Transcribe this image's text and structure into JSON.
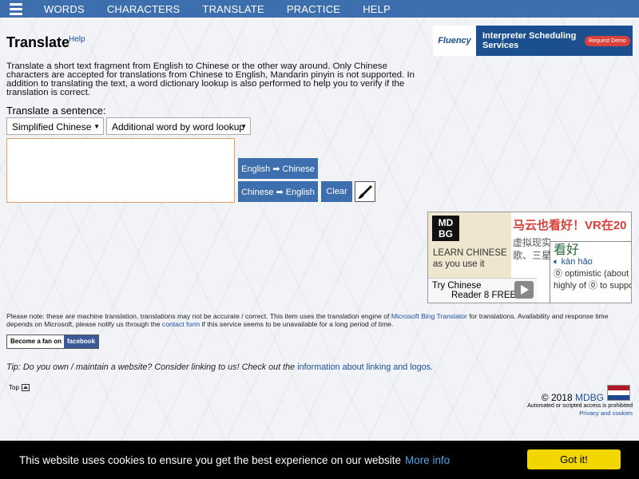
{
  "nav": {
    "items": [
      "WORDS",
      "CHARACTERS",
      "TRANSLATE",
      "PRACTICE",
      "HELP"
    ]
  },
  "page": {
    "title": "Translate",
    "help_label": "Help",
    "intro": "Translate a short text fragment from English to Chinese or the other way around. Only Chinese characters are accepted for translations from Chinese to English, Mandarin pinyin is not supported. In addition to translating the text, a word dictionary lookup is also performed to help you to verify if the translation is correct.",
    "sentence_label": "Translate a sentence:"
  },
  "form": {
    "language_select": "Simplified Chinese",
    "mode_select": "Additional word by word lookup",
    "textarea_value": "",
    "btn_en_zh": "English ➡ Chinese",
    "btn_zh_en": "Chinese ➡ English",
    "btn_clear": "Clear",
    "brush_icon": "brush-icon"
  },
  "ad_top": {
    "logo": "Fluency",
    "text": "Interpreter Scheduling Services",
    "button": "Request Demo"
  },
  "ad_mdbg": {
    "logo_line1": "MD",
    "logo_line2": "BG",
    "learn_line1": "LEARN CHINESE",
    "learn_line2": "as you use it",
    "try_line1": "Try Chinese",
    "try_line2": "Reader 8 FREE",
    "headline": "马云也看好！VR在20",
    "sub_line1": "虚拟现实",
    "sub_line2": "歌、三星",
    "popup_hanzi": "看好",
    "popup_pinyin": "kàn hǎo",
    "popup_def1": "optimistic (about",
    "popup_def2": "highly of ⓪ to suppo"
  },
  "disclaimer": {
    "part1": "Please note: these are machine translation, translations may not be accurate / correct. This item uses the translation engine of ",
    "link1": "Microsoft Bing Translator",
    "part2": " for translations. Availability and response time depends on Microsoft, please notify us through the ",
    "link2": "contact form",
    "part3": " if this service seems to be unavailable for a long period of time."
  },
  "facebook": {
    "left": "Become a fan on",
    "right": "facebook"
  },
  "tip": {
    "text": "Tip: Do you own / maintain a website? Consider linking to us! Check out the ",
    "link": "information about linking and logos",
    "end": "."
  },
  "footer": {
    "top_label": "Top",
    "copyright": "© 2018 ",
    "brand": "MDBG",
    "automated": "Automated or scripted access is prohibited",
    "privacy": "Privacy and cookies",
    "flag_colors": [
      "#ae1c28",
      "#ffffff",
      "#21468b"
    ]
  },
  "cookie": {
    "text": "This website uses cookies to ensure you get the best experience on our website",
    "more": "More info",
    "button": "Got it!"
  }
}
